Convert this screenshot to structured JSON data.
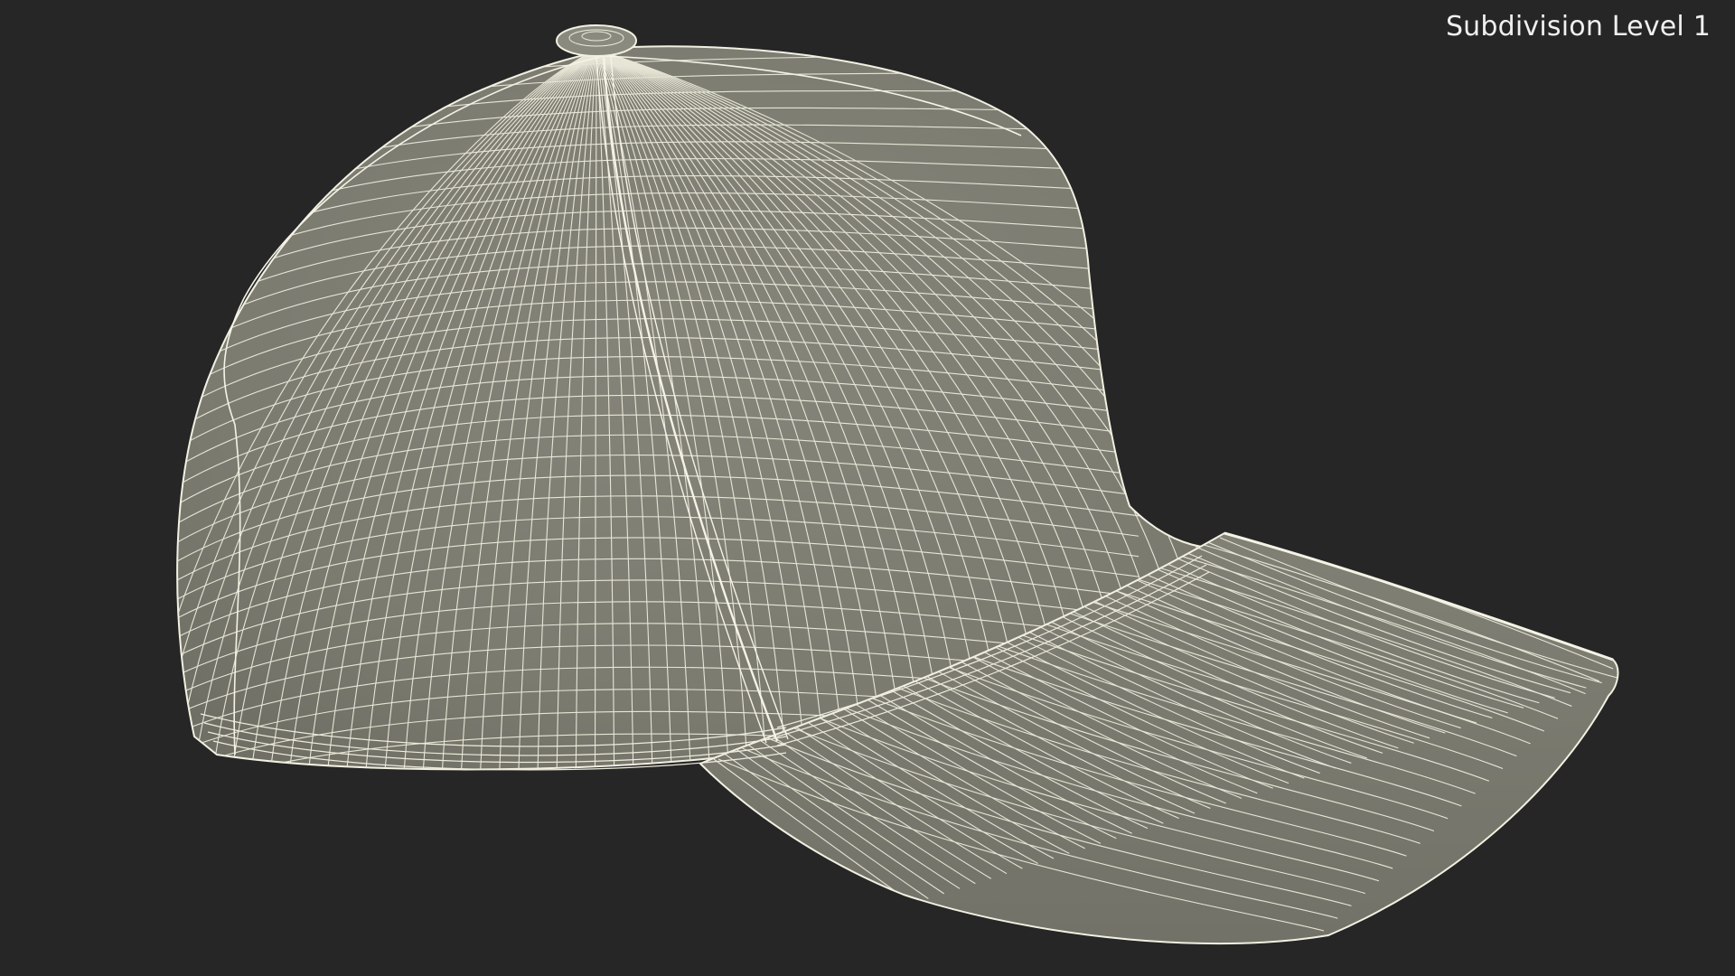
{
  "viewport": {
    "label": "Subdivision Level 1",
    "background_color": "#262626",
    "mesh_fill_color": "#7d7d72",
    "wire_color": "#f2f0e2"
  },
  "model": {
    "name": "baseball-cap",
    "display_mode": "wireframe-on-shaded"
  }
}
